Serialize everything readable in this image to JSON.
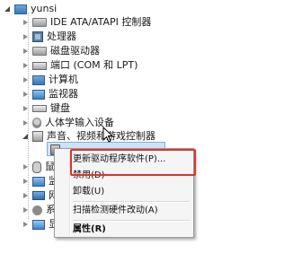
{
  "tree": {
    "root": "yunsi",
    "items": [
      {
        "label": "IDE ATA/ATAPI 控制器",
        "icon": "disk-controller-icon"
      },
      {
        "label": "处理器",
        "icon": "processor-icon"
      },
      {
        "label": "磁盘驱动器",
        "icon": "disk-drive-icon"
      },
      {
        "label": "端口 (COM 和 LPT)",
        "icon": "port-icon"
      },
      {
        "label": "计算机",
        "icon": "computer-icon"
      },
      {
        "label": "监视器",
        "icon": "monitor-icon"
      },
      {
        "label": "键盘",
        "icon": "keyboard-icon"
      },
      {
        "label": "人体学输入设备",
        "icon": "hid-icon"
      },
      {
        "label": "声音、视频和游戏控制器",
        "icon": "sound-icon"
      }
    ],
    "selected_child_icon": "speaker-icon",
    "partial_rows": [
      {
        "label": "鼠",
        "icon": "mouse-icon"
      },
      {
        "label": "监",
        "icon": "monitor-icon"
      },
      {
        "label": "网",
        "icon": "network-icon"
      },
      {
        "label": "系",
        "icon": "system-icon"
      },
      {
        "label": "显",
        "icon": "display-adapter-icon"
      }
    ]
  },
  "context_menu": {
    "items": [
      "更新驱动程序软件(P)...",
      "禁用(D)",
      "卸载(U)",
      "扫描检测硬件改动(A)",
      "属性(R)"
    ]
  },
  "colors": {
    "highlight_border": "#d9372c",
    "selection_fill": "#cfe3f8"
  }
}
